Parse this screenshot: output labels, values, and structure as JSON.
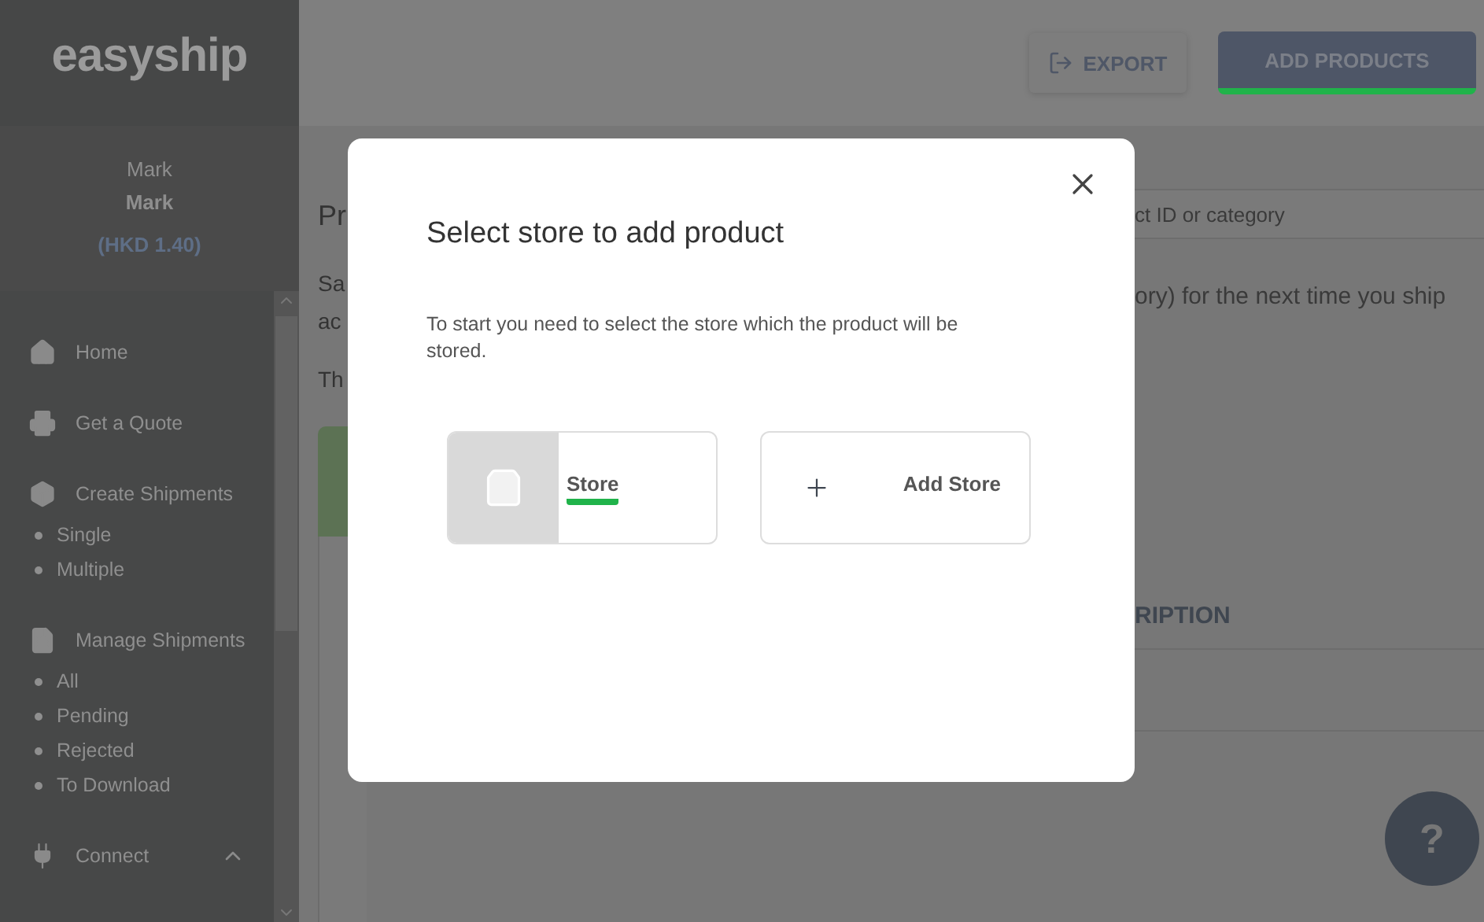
{
  "logo": "easyship",
  "user": {
    "name": "Mark",
    "company": "Mark",
    "balance": "(HKD 1.40)"
  },
  "nav": [
    {
      "kind": "item",
      "label": "Home"
    },
    {
      "kind": "item",
      "label": "Get a Quote"
    },
    {
      "kind": "item",
      "label": "Create Shipments",
      "children": [
        {
          "label": "Single"
        },
        {
          "label": "Multiple"
        }
      ]
    },
    {
      "kind": "item",
      "label": "Manage Shipments",
      "children": [
        {
          "label": "All"
        },
        {
          "label": "Pending"
        },
        {
          "label": "Rejected"
        },
        {
          "label": "To Download"
        }
      ]
    },
    {
      "kind": "collapsible",
      "label": "Connect",
      "expanded": true
    }
  ],
  "header_buttons": [
    {
      "kind": "export",
      "label": "EXPORT",
      "selected": false
    },
    {
      "kind": "primary",
      "label": "ADD PRODUCTS",
      "selected": true
    }
  ],
  "page": {
    "title_fragment": "Pr",
    "text_fragments": [
      "Sa",
      "ac",
      "Th"
    ],
    "search_placeholder": "ct ID or category",
    "text_tail": "ory) for the next time you ship",
    "column_header": "RIPTION"
  },
  "modal": {
    "title": "Select store to add product",
    "text": "To start you need to select the store which the product will be stored.",
    "stores": [
      {
        "kind": "store",
        "label": "Store",
        "selected": true
      },
      {
        "kind": "add",
        "label": "Add Store",
        "selected": false
      }
    ]
  },
  "help": "?"
}
